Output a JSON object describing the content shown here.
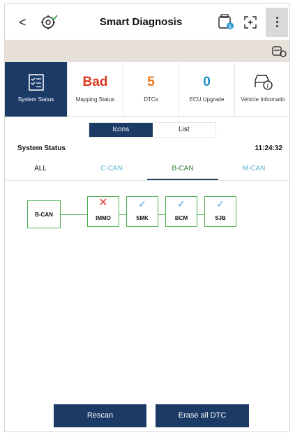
{
  "header": {
    "back_glyph": "<",
    "title": "Smart Diagnosis"
  },
  "summary_tiles": [
    {
      "label": "System Status",
      "icon": "checklist-icon"
    },
    {
      "value": "Bad",
      "label": "Mapping Status",
      "color": "#d9381e"
    },
    {
      "value": "5",
      "label": "DTCs",
      "color": "#e8751a"
    },
    {
      "value": "0",
      "label": "ECU Upgrade",
      "color": "#1b8fc6"
    },
    {
      "label": "Vehicle Informatio",
      "icon": "vehicle-info-icon"
    }
  ],
  "view_toggle": {
    "icons": "Icons",
    "list": "List",
    "selected": "Icons"
  },
  "system_status": {
    "title": "System Status",
    "time": "11:24:32"
  },
  "bus_tabs": [
    "ALL",
    "C-CAN",
    "B-CAN",
    "M-CAN"
  ],
  "selected_tab": "B-CAN",
  "diagram": {
    "bus": "B-CAN",
    "modules": [
      {
        "name": "IMMO",
        "status": "fail",
        "mark": "✕"
      },
      {
        "name": "SMK",
        "status": "ok",
        "mark": "✓"
      },
      {
        "name": "BCM",
        "status": "ok",
        "mark": "✓"
      },
      {
        "name": "SJB",
        "status": "ok",
        "mark": "✓"
      }
    ]
  },
  "actions": {
    "rescan": "Rescan",
    "erase": "Erase all DTC"
  },
  "colors": {
    "accent": "#1b3a66",
    "ok": "#4caf50",
    "fail": "#e53935",
    "tab_inactive": "#5ab0d0"
  }
}
